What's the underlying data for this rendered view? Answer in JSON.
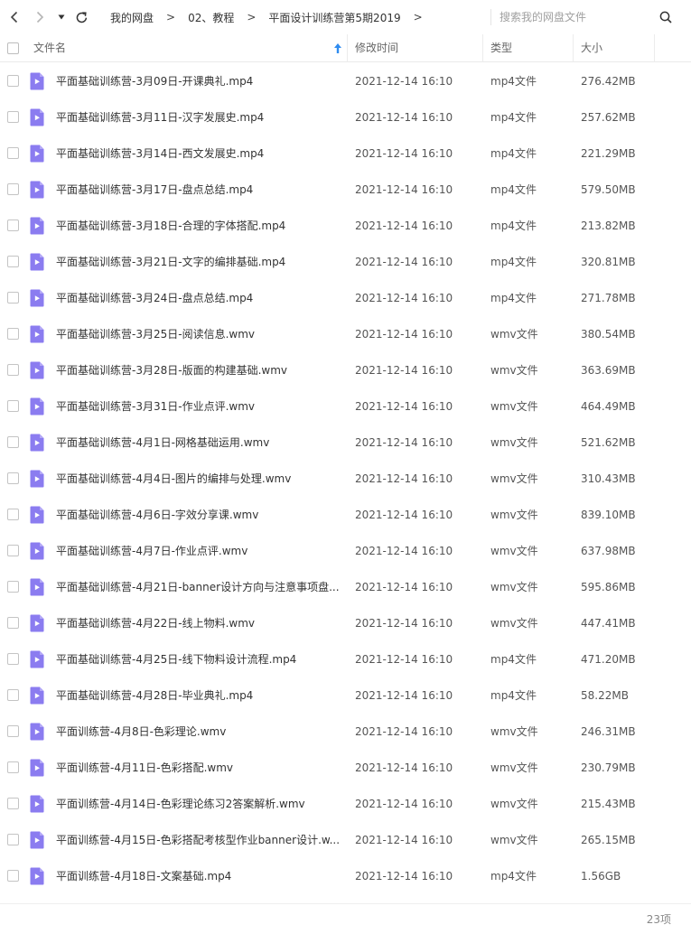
{
  "toolbar": {
    "search_placeholder": "搜索我的网盘文件"
  },
  "breadcrumb": {
    "items": [
      "我的网盘",
      "02、教程",
      "平面设计训练营第5期2019"
    ],
    "separator": ">"
  },
  "table": {
    "columns": {
      "name": "文件名",
      "modified": "修改时间",
      "type": "类型",
      "size": "大小"
    },
    "sort": "name-ascending",
    "rows": [
      {
        "name": "平面基础训练营-3月09日-开课典礼.mp4",
        "time": "2021-12-14 16:10",
        "type": "mp4文件",
        "size": "276.42MB"
      },
      {
        "name": "平面基础训练营-3月11日-汉字发展史.mp4",
        "time": "2021-12-14 16:10",
        "type": "mp4文件",
        "size": "257.62MB"
      },
      {
        "name": "平面基础训练营-3月14日-西文发展史.mp4",
        "time": "2021-12-14 16:10",
        "type": "mp4文件",
        "size": "221.29MB"
      },
      {
        "name": "平面基础训练营-3月17日-盘点总结.mp4",
        "time": "2021-12-14 16:10",
        "type": "mp4文件",
        "size": "579.50MB"
      },
      {
        "name": "平面基础训练营-3月18日-合理的字体搭配.mp4",
        "time": "2021-12-14 16:10",
        "type": "mp4文件",
        "size": "213.82MB"
      },
      {
        "name": "平面基础训练营-3月21日-文字的编排基础.mp4",
        "time": "2021-12-14 16:10",
        "type": "mp4文件",
        "size": "320.81MB"
      },
      {
        "name": "平面基础训练营-3月24日-盘点总结.mp4",
        "time": "2021-12-14 16:10",
        "type": "mp4文件",
        "size": "271.78MB"
      },
      {
        "name": "平面基础训练营-3月25日-阅读信息.wmv",
        "time": "2021-12-14 16:10",
        "type": "wmv文件",
        "size": "380.54MB"
      },
      {
        "name": "平面基础训练营-3月28日-版面的构建基础.wmv",
        "time": "2021-12-14 16:10",
        "type": "wmv文件",
        "size": "363.69MB"
      },
      {
        "name": "平面基础训练营-3月31日-作业点评.wmv",
        "time": "2021-12-14 16:10",
        "type": "wmv文件",
        "size": "464.49MB"
      },
      {
        "name": "平面基础训练营-4月1日-网格基础运用.wmv",
        "time": "2021-12-14 16:10",
        "type": "wmv文件",
        "size": "521.62MB"
      },
      {
        "name": "平面基础训练营-4月4日-图片的编排与处理.wmv",
        "time": "2021-12-14 16:10",
        "type": "wmv文件",
        "size": "310.43MB"
      },
      {
        "name": "平面基础训练营-4月6日-字效分享课.wmv",
        "time": "2021-12-14 16:10",
        "type": "wmv文件",
        "size": "839.10MB"
      },
      {
        "name": "平面基础训练营-4月7日-作业点评.wmv",
        "time": "2021-12-14 16:10",
        "type": "wmv文件",
        "size": "637.98MB"
      },
      {
        "name": "平面基础训练营-4月21日-banner设计方向与注意事项盘...",
        "time": "2021-12-14 16:10",
        "type": "wmv文件",
        "size": "595.86MB"
      },
      {
        "name": "平面基础训练营-4月22日-线上物料.wmv",
        "time": "2021-12-14 16:10",
        "type": "wmv文件",
        "size": "447.41MB"
      },
      {
        "name": "平面基础训练营-4月25日-线下物料设计流程.mp4",
        "time": "2021-12-14 16:10",
        "type": "mp4文件",
        "size": "471.20MB"
      },
      {
        "name": "平面基础训练营-4月28日-毕业典礼.mp4",
        "time": "2021-12-14 16:10",
        "type": "mp4文件",
        "size": "58.22MB"
      },
      {
        "name": "平面训练营-4月8日-色彩理论.wmv",
        "time": "2021-12-14 16:10",
        "type": "wmv文件",
        "size": "246.31MB"
      },
      {
        "name": "平面训练营-4月11日-色彩搭配.wmv",
        "time": "2021-12-14 16:10",
        "type": "wmv文件",
        "size": "230.79MB"
      },
      {
        "name": "平面训练营-4月14日-色彩理论练习2答案解析.wmv",
        "time": "2021-12-14 16:10",
        "type": "wmv文件",
        "size": "215.43MB"
      },
      {
        "name": "平面训练营-4月15日-色彩搭配考核型作业banner设计.w...",
        "time": "2021-12-14 16:10",
        "type": "wmv文件",
        "size": "265.15MB"
      },
      {
        "name": "平面训练营-4月18日-文案基础.mp4",
        "time": "2021-12-14 16:10",
        "type": "mp4文件",
        "size": "1.56GB"
      }
    ]
  },
  "footer": {
    "count": "23项"
  },
  "colors": {
    "video_icon": "#8b7cf0",
    "video_icon_fold": "#b3a8f7",
    "sort_arrow": "#2f8cf0",
    "header_text": "#666666",
    "row_text": "#333333"
  },
  "icons": {
    "back": "chevron-left-icon",
    "forward": "chevron-right-icon",
    "history": "dropdown-caret-icon",
    "refresh": "refresh-icon",
    "search": "search-icon",
    "file": "video-file-icon",
    "sort": "sort-ascending-arrow-icon"
  }
}
